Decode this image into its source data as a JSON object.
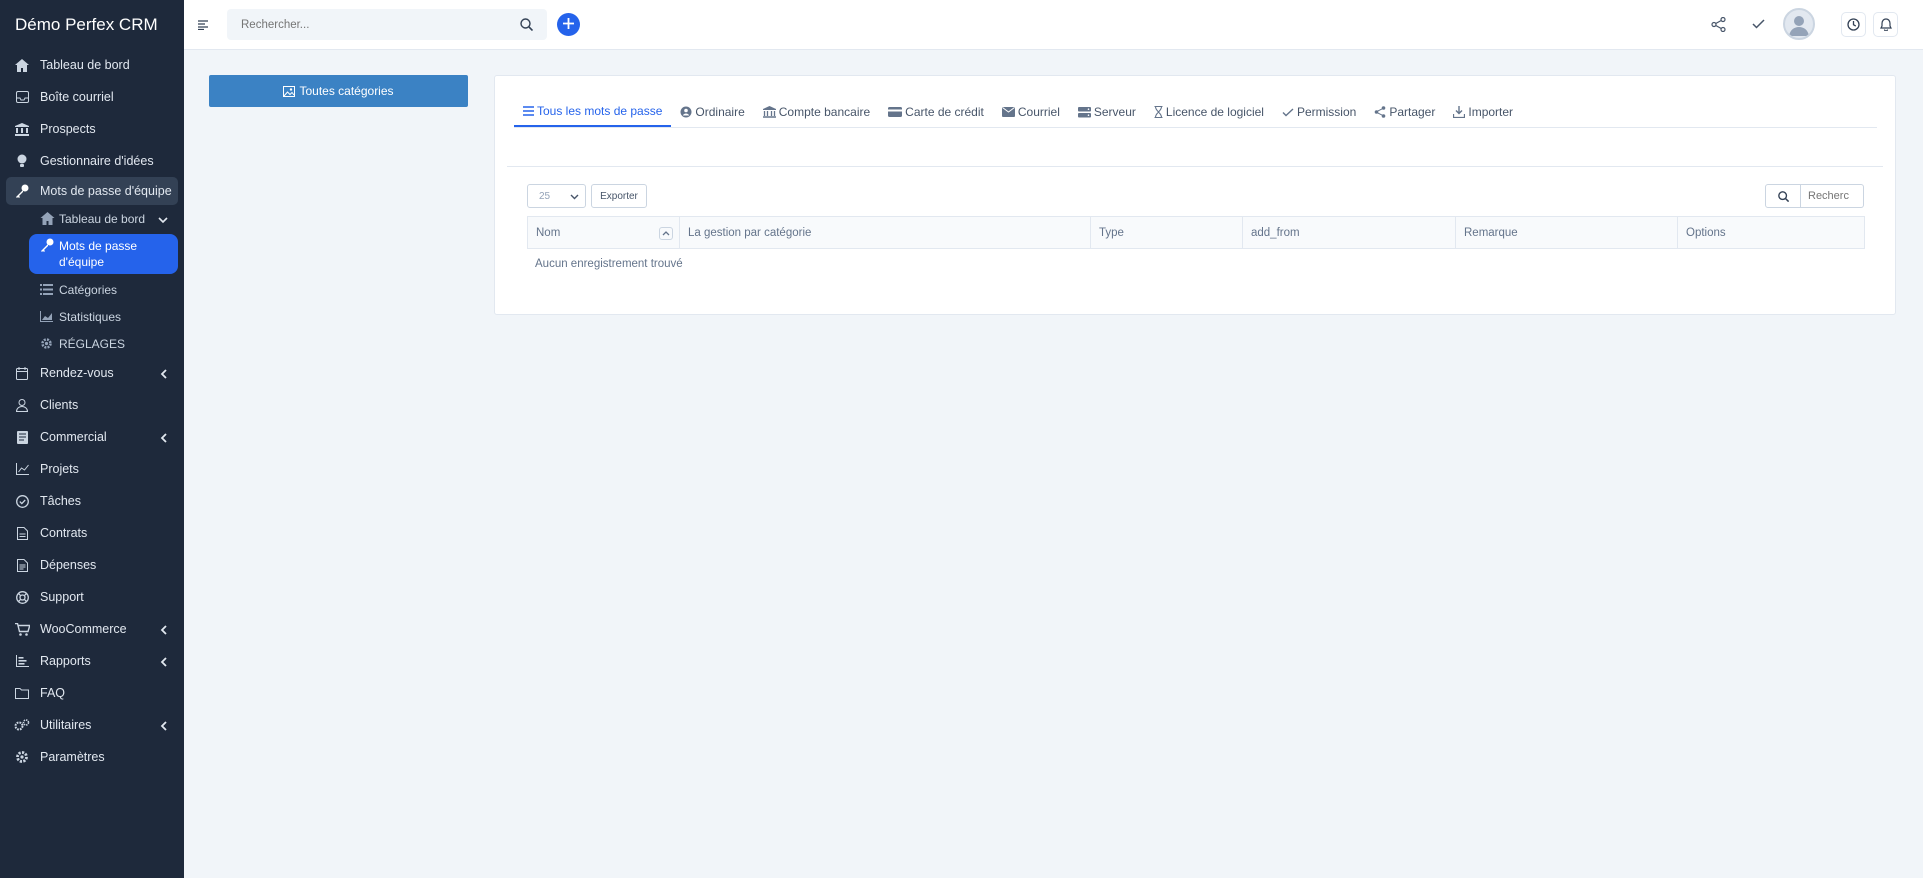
{
  "brand": "Démo Perfex CRM",
  "sidebar": {
    "items": [
      {
        "label": "Tableau de bord",
        "icon": "home-icon"
      },
      {
        "label": "Boîte courriel",
        "icon": "inbox-icon"
      },
      {
        "label": "Prospects",
        "icon": "building-icon"
      },
      {
        "label": "Gestionnaire d'idées",
        "icon": "lightbulb-icon"
      },
      {
        "label": "Mots de passe d'équipe",
        "icon": "key-icon"
      },
      {
        "label": "Rendez-vous",
        "icon": "calendar-icon"
      },
      {
        "label": "Clients",
        "icon": "user-icon"
      },
      {
        "label": "Commercial",
        "icon": "receipt-icon"
      },
      {
        "label": "Projets",
        "icon": "chart-icon"
      },
      {
        "label": "Tâches",
        "icon": "check-circle-icon"
      },
      {
        "label": "Contrats",
        "icon": "document-icon"
      },
      {
        "label": "Dépenses",
        "icon": "file-text-icon"
      },
      {
        "label": "Support",
        "icon": "lifebuoy-icon"
      },
      {
        "label": "WooCommerce",
        "icon": "cart-icon"
      },
      {
        "label": "Rapports",
        "icon": "bar-chart-icon"
      },
      {
        "label": "FAQ",
        "icon": "folder-icon"
      },
      {
        "label": "Utilitaires",
        "icon": "cogs-icon"
      },
      {
        "label": "Paramètres",
        "icon": "gear-icon"
      }
    ],
    "subitems": [
      {
        "label": "Tableau de bord",
        "icon": "home-icon"
      },
      {
        "label": "Mots de passe d'équipe",
        "icon": "key-icon"
      },
      {
        "label": "Catégories",
        "icon": "list-icon"
      },
      {
        "label": "Statistiques",
        "icon": "area-chart-icon"
      },
      {
        "label": "RÉGLAGES",
        "icon": "gear-icon"
      }
    ]
  },
  "topbar": {
    "search_placeholder": "Rechercher..."
  },
  "category_button": "Toutes catégories",
  "tabs": [
    {
      "label": "Tous les mots de passe",
      "icon": "bars-icon"
    },
    {
      "label": "Ordinaire",
      "icon": "user-circle-icon"
    },
    {
      "label": "Compte bancaire",
      "icon": "bank-icon"
    },
    {
      "label": "Carte de crédit",
      "icon": "credit-card-icon"
    },
    {
      "label": "Courriel",
      "icon": "envelope-icon"
    },
    {
      "label": "Serveur",
      "icon": "server-icon"
    },
    {
      "label": "Licence de logiciel",
      "icon": "hourglass-icon"
    },
    {
      "label": "Permission",
      "icon": "check-icon"
    },
    {
      "label": "Partager",
      "icon": "share-icon"
    },
    {
      "label": "Importer",
      "icon": "download-icon"
    }
  ],
  "table": {
    "page_length": "25",
    "export_label": "Exporter",
    "search_placeholder": "Recherc",
    "columns": [
      "Nom",
      "La gestion par catégorie",
      "Type",
      "add_from",
      "Remarque",
      "Options"
    ],
    "empty_message": "Aucun enregistrement trouvé"
  },
  "colors": {
    "sidebar_bg": "#1e293b",
    "accent": "#2563eb",
    "category_button": "#3b82c4"
  }
}
